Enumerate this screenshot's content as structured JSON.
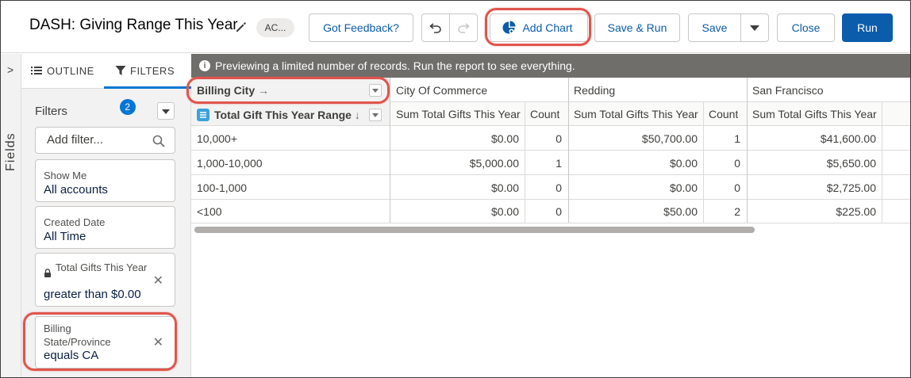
{
  "header": {
    "title": "DASH: Giving Range This Year",
    "badge": "AC...",
    "feedback_label": "Got Feedback?",
    "add_chart_label": "Add Chart",
    "save_run_label": "Save & Run",
    "save_label": "Save",
    "close_label": "Close",
    "run_label": "Run"
  },
  "rail": {
    "label": "Fields",
    "chevron": ">"
  },
  "panel": {
    "tabs": {
      "outline": "OUTLINE",
      "filters": "FILTERS",
      "filters_count": "2"
    },
    "filters_title": "Filters",
    "search_placeholder": "Add filter...",
    "filters": [
      {
        "label": "Show Me",
        "value": "All accounts"
      },
      {
        "label": "Created Date",
        "value": "All Time"
      },
      {
        "label": "Total Gifts This Year",
        "value": "greater than $0.00",
        "locked": true
      },
      {
        "label": "Billing State/Province",
        "value": "equals CA"
      }
    ]
  },
  "report": {
    "banner": "Previewing a limited number of records. Run the report to see everything.",
    "column_group_label": "Billing City",
    "row_group_label": "Total Gift This Year Range",
    "cities": [
      "City Of Commerce",
      "Redding",
      "San Francisco"
    ],
    "measure_labels": {
      "sum": "Sum Total Gifts This Year",
      "count": "Count"
    },
    "rows": [
      {
        "range": "10,000+",
        "values": [
          [
            "$0.00",
            "0"
          ],
          [
            "$50,700.00",
            "1"
          ],
          [
            "$41,600.00",
            ""
          ]
        ]
      },
      {
        "range": "1,000-10,000",
        "values": [
          [
            "$5,000.00",
            "1"
          ],
          [
            "$0.00",
            "0"
          ],
          [
            "$5,650.00",
            ""
          ]
        ]
      },
      {
        "range": "100-1,000",
        "values": [
          [
            "$0.00",
            "0"
          ],
          [
            "$0.00",
            "0"
          ],
          [
            "$2,725.00",
            ""
          ]
        ]
      },
      {
        "range": "<100",
        "values": [
          [
            "$0.00",
            "0"
          ],
          [
            "$50.00",
            "2"
          ],
          [
            "$225.00",
            ""
          ]
        ]
      }
    ]
  },
  "colors": {
    "brand": "#0b5cab",
    "highlight": "#e0554d",
    "banner": "#706e6b",
    "tab_accent": "#0176d3"
  }
}
